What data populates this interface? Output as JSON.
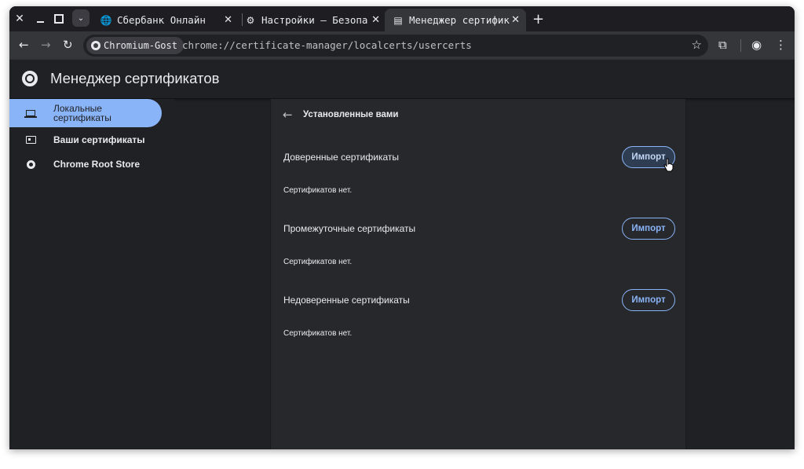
{
  "window_controls": {
    "close": "✕",
    "search_tabs": "⌄"
  },
  "tabs": [
    {
      "title": "Сбербанк Онлайн",
      "icon": "globe-icon",
      "close": "✕"
    },
    {
      "title": "Настройки – Безопа",
      "icon": "gear-icon",
      "close": "✕"
    },
    {
      "title": "Менеджер сертифика",
      "icon": "certificate-icon",
      "close": "✕",
      "active": true
    }
  ],
  "new_tab": "+",
  "toolbar": {
    "back": "←",
    "forward": "→",
    "reload": "↻",
    "site_chip": "Chromium-Gost",
    "url": "chrome://certificate-manager/localcerts/usercerts",
    "star": "☆",
    "extensions": "⧉",
    "profile": "◉",
    "menu": "⋮"
  },
  "page": {
    "title": "Менеджер сертификатов"
  },
  "sidebar": {
    "items": [
      {
        "label_line1": "Локальные",
        "label_line2": "сертификаты",
        "icon": "laptop-icon",
        "selected": true
      },
      {
        "label": "Ваши сертификаты",
        "icon": "card-icon"
      },
      {
        "label": "Chrome Root Store",
        "icon": "chrome-icon"
      }
    ]
  },
  "content": {
    "back": "←",
    "subpage_title": "Установленные вами",
    "sections": [
      {
        "title": "Доверенные сертификаты",
        "empty": "Сертификатов нет.",
        "button": "Импорт"
      },
      {
        "title": "Промежуточные сертификаты",
        "empty": "Сертификатов нет.",
        "button": "Импорт"
      },
      {
        "title": "Недоверенные сертификаты",
        "empty": "Сертификатов нет.",
        "button": "Импорт"
      }
    ]
  },
  "colors": {
    "accent": "#8ab4f8",
    "background": "#202124",
    "card": "#27282b",
    "text": "#e8eaed"
  }
}
